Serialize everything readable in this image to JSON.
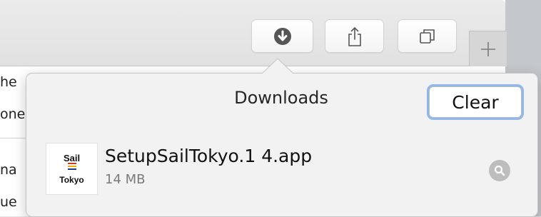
{
  "toolbar": {
    "downloads_icon": "download-arrow-icon",
    "share_icon": "share-icon",
    "tabs_icon": "tab-overview-icon",
    "newtab_icon": "plus-icon"
  },
  "background_text": [
    "he",
    "one",
    "na",
    "ue"
  ],
  "downloads": {
    "title": "Downloads",
    "clear_label": "Clear",
    "items": [
      {
        "icon_text_top": "Sail",
        "icon_text_bottom": "Tokyo",
        "stripe_colors": [
          "#d4351c",
          "#f2a900",
          "#1f3c88"
        ],
        "name": "SetupSailTokyo.1 4.app",
        "size": "14 MB"
      }
    ]
  },
  "colors": {
    "accent_ring": "#8fb8ef",
    "toolbar_icon": "#555555",
    "magnifier_bg": "#bdbdbd"
  }
}
